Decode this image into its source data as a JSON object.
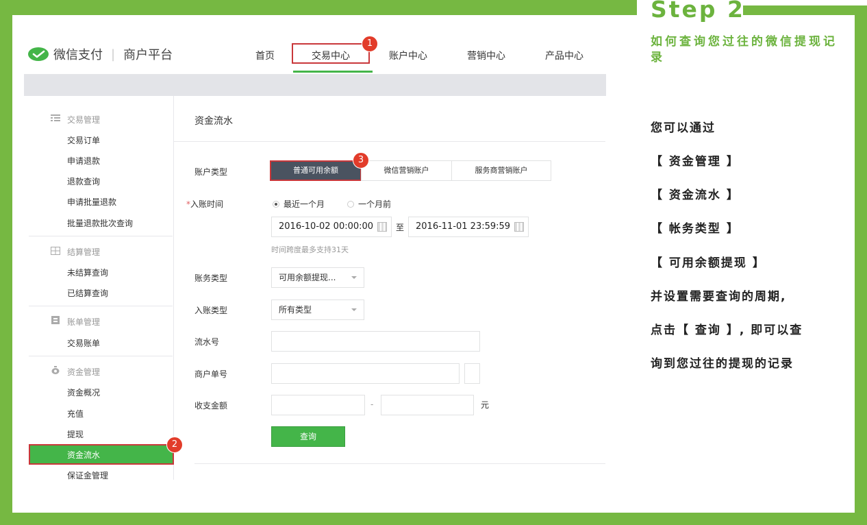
{
  "step": {
    "title": "Step 2",
    "subtitle": "如何查询您过往的微信提现记录"
  },
  "instructions": [
    "您可以通过",
    "【 资金管理 】",
    "【 资金流水 】",
    "【 帐务类型 】",
    "【 可用余额提现 】",
    "并设置需要查询的周期,",
    "点击【 查询 】, 即可以查",
    "询到您过往的提现的记录"
  ],
  "header": {
    "brand": "微信支付",
    "platform": "商户平台",
    "nav": [
      "首页",
      "交易中心",
      "账户中心",
      "营销中心",
      "产品中心"
    ],
    "active_nav": "交易中心"
  },
  "badges": [
    "1",
    "2",
    "3"
  ],
  "sidebar": {
    "groups": [
      {
        "label": "交易管理",
        "icon": "list-icon",
        "items": [
          "交易订单",
          "申请退款",
          "退款查询",
          "申请批量退款",
          "批量退款批次查询"
        ]
      },
      {
        "label": "结算管理",
        "icon": "grid-icon",
        "items": [
          "未结算查询",
          "已结算查询"
        ]
      },
      {
        "label": "账单管理",
        "icon": "bill-icon",
        "items": [
          "交易账单"
        ]
      },
      {
        "label": "资金管理",
        "icon": "money-bag-icon",
        "items": [
          "资金概况",
          "充值",
          "提现",
          "资金流水",
          "保证金管理"
        ]
      }
    ],
    "active_item": "资金流水"
  },
  "content": {
    "title": "资金流水",
    "account_type_label": "账户类型",
    "account_types": [
      "普通可用余额",
      "微信营销账户",
      "服务商营销账户"
    ],
    "active_account_type": "普通可用余额",
    "entry_time_label": "入账时间",
    "required_mark": "*",
    "time_options": [
      "最近一个月",
      "一个月前"
    ],
    "selected_time_option": "最近一个月",
    "start_date": "2016-10-02 00:00:00",
    "date_sep": "至",
    "end_date": "2016-11-01 23:59:59",
    "date_hint": "时间跨度最多支持31天",
    "bill_type_label": "账务类型",
    "bill_type_value": "可用余额提现...",
    "entry_type_label": "入账类型",
    "entry_type_value": "所有类型",
    "serial_label": "流水号",
    "merchant_no_label": "商户单号",
    "amount_label": "收支金额",
    "amount_sep": "-",
    "amount_unit": "元",
    "query_button": "查询"
  },
  "colors": {
    "frame_green": "#76b842",
    "accent_green": "#44b549",
    "highlight_red": "#c9373a",
    "badge_red": "#e23c2a",
    "active_segment": "#4a5360"
  }
}
